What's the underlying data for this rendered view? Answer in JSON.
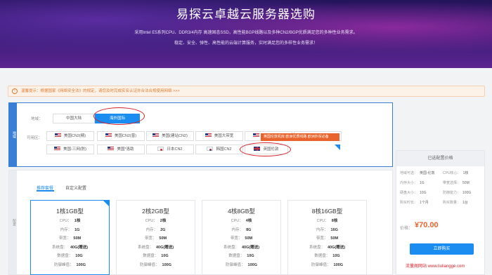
{
  "hero": {
    "title": "易探云卓越云服务器选购",
    "line1": "采用Intel E5系列CPU、DDR3/4内存 高速固态SSD，高性能BGP线路以及多种CN2/BGP优质满足您的多种性业务需求。",
    "line2": "稳定、安全、弹性、高性能的云端计算服务，实时满足您的多样性业务需求！"
  },
  "notice": {
    "icon": "!",
    "text": "温馨提示：根据国家《网络安全法》的规定，请您及时完成实名认证并合法合规使用网络 >>>"
  },
  "region": {
    "side_tab": "地域",
    "area_label": "地域：",
    "area_options": [
      "中国大陆",
      "海外国际"
    ],
    "zone_label": "可用区：",
    "zones_row1": [
      {
        "flag": "us",
        "label": "美国CN2(精)"
      },
      {
        "flag": "us",
        "label": "美国CN2(普)"
      },
      {
        "flag": "us",
        "label": "美国(建站CN2)"
      },
      {
        "flag": "us",
        "label": "美国大带宽"
      },
      {
        "flag": "us",
        "label": "美国(洛杉矶)"
      },
      {
        "flag": "us",
        "label": "美国(圣何塞)"
      }
    ],
    "zones_row2": [
      {
        "flag": "us",
        "label": "美国-三网(防)"
      },
      {
        "flag": "us",
        "label": "美国*洛助"
      },
      {
        "flag": "jp",
        "label": "日本CN2"
      },
      {
        "flag": "kr",
        "label": "韩国CN2"
      },
      {
        "flag": "uk",
        "label": "英国伦敦"
      }
    ],
    "tooltip": "英国伦敦机房 欧洲优质线路 欧洲外贸必备"
  },
  "config": {
    "side_tab": "配置",
    "tabs": [
      "推荐套餐",
      "自定义配置"
    ],
    "cards": [
      {
        "title": "1核1GB型",
        "specs": [
          [
            "CPU：",
            "1核"
          ],
          [
            "内存：",
            "1G"
          ],
          [
            "带宽：",
            "50M"
          ],
          [
            "系统盘：",
            "40G(赠送)"
          ],
          [
            "数据盘：",
            "10G"
          ],
          [
            "防御峰值：",
            "100G"
          ]
        ]
      },
      {
        "title": "2核2GB型",
        "specs": [
          [
            "CPU：",
            "2核"
          ],
          [
            "内存：",
            "2G"
          ],
          [
            "带宽：",
            "50M"
          ],
          [
            "系统盘：",
            "40G(赠送)"
          ],
          [
            "数据盘：",
            "10G"
          ],
          [
            "防御峰值：",
            "100G"
          ]
        ]
      },
      {
        "title": "4核8GB型",
        "specs": [
          [
            "CPU：",
            "4核"
          ],
          [
            "内存：",
            "8G"
          ],
          [
            "带宽：",
            "50M"
          ],
          [
            "系统盘：",
            "40G(赠送)"
          ],
          [
            "数据盘：",
            "10G"
          ],
          [
            "防御峰值：",
            "100G"
          ]
        ]
      },
      {
        "title": "8核16GB型",
        "specs": [
          [
            "CPU：",
            "8核"
          ],
          [
            "内存：",
            "16G"
          ],
          [
            "带宽：",
            "50M"
          ],
          [
            "系统盘：",
            "40G(赠送)"
          ],
          [
            "数据盘：",
            "10G"
          ],
          [
            "防御峰值：",
            "100G"
          ]
        ]
      }
    ]
  },
  "summary": {
    "header": "已选配置价格",
    "rows": [
      [
        "地域可选：",
        "英国-伦敦",
        "CPU核心：",
        "1核"
      ],
      [
        "内存大小：",
        "1G",
        "带宽选择：",
        "50M"
      ],
      [
        "硬盘大小：",
        "10G",
        "防御能力：",
        "100G"
      ],
      [
        "购买时长：",
        "1个月",
        "购买数量：",
        "1台"
      ]
    ],
    "price_label": "价格：",
    "price": "¥70.00",
    "buy_label": "立即购买"
  },
  "watermark": "流量阁网站 www.liuliangge.com",
  "colors": {
    "accent": "#1b8cf0",
    "warning": "#e8642c",
    "ring": "#d6202a"
  }
}
